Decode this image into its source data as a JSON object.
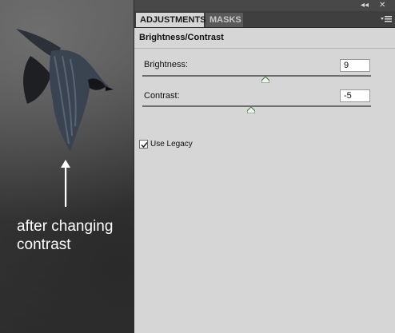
{
  "caption": {
    "line1": "after changing",
    "line2": "contrast"
  },
  "panel": {
    "tabs": [
      {
        "label": "ADJUSTMENTS",
        "active": true
      },
      {
        "label": "MASKS",
        "active": false
      }
    ],
    "title": "Brightness/Contrast",
    "brightness": {
      "label": "Brightness:",
      "value": "9",
      "slider_level": 0.54
    },
    "contrast": {
      "label": "Contrast:",
      "value": "-5",
      "slider_level": 0.475
    },
    "use_legacy": {
      "label": "Use Legacy",
      "checked": true
    },
    "icons": {
      "collapse": "collapse-icon",
      "close": "close-icon",
      "menu": "panel-menu-icon"
    }
  },
  "colors": {
    "panel_bg": "#d6d6d6",
    "tabbar_bg": "#3f3f3f",
    "slider_thumb": "#3a7a3a"
  }
}
